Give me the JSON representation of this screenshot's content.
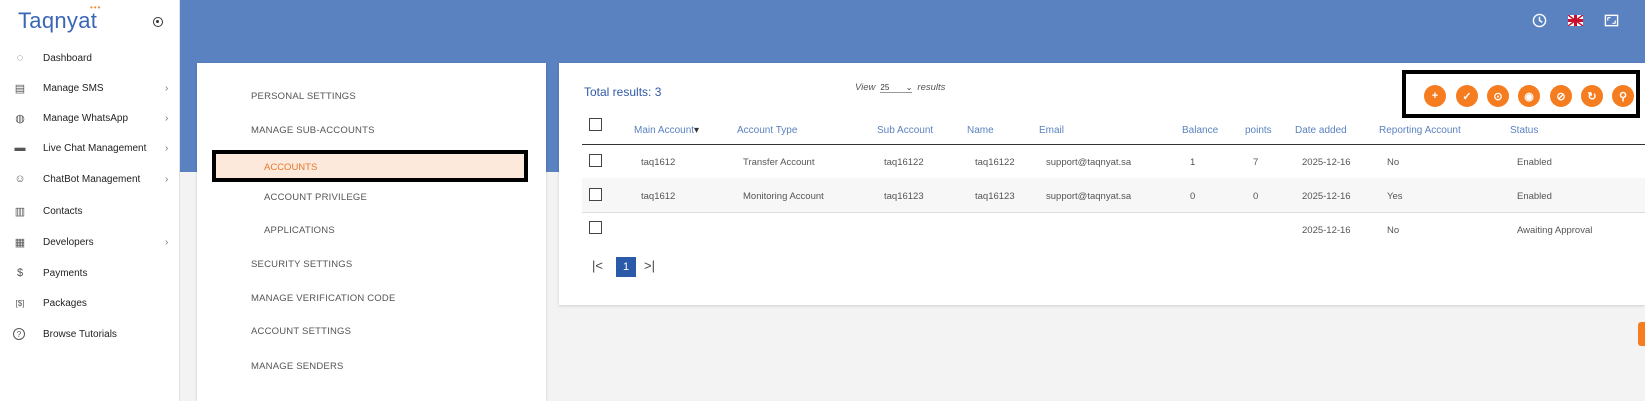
{
  "brand": {
    "name": "Taqnyat",
    "dots": "•••"
  },
  "sidebar": {
    "items": [
      {
        "label": "Dashboard",
        "icon": "dashboard-icon",
        "glyph": "◌",
        "chevron": false
      },
      {
        "label": "Manage SMS",
        "icon": "sms-icon",
        "glyph": "▤",
        "chevron": true
      },
      {
        "label": "Manage WhatsApp",
        "icon": "whatsapp-icon",
        "glyph": "◍",
        "chevron": true
      },
      {
        "label": "Live Chat Management",
        "icon": "chat-icon",
        "glyph": "▬",
        "chevron": true
      },
      {
        "label": "ChatBot Management",
        "icon": "robot-icon",
        "glyph": "☺",
        "chevron": true
      },
      {
        "label": "Contacts",
        "icon": "contacts-icon",
        "glyph": "▥",
        "chevron": false
      },
      {
        "label": "Developers",
        "icon": "developers-icon",
        "glyph": "▦",
        "chevron": true
      },
      {
        "label": "Payments",
        "icon": "dollar-icon",
        "glyph": "$",
        "chevron": false
      },
      {
        "label": "Packages",
        "icon": "packages-icon",
        "glyph": "[$]",
        "chevron": false
      },
      {
        "label": "Browse Tutorials",
        "icon": "help-icon",
        "glyph": "?",
        "chevron": false
      }
    ]
  },
  "topbar": {
    "icons": [
      "clock-icon",
      "uk-flag-icon",
      "fullscreen-icon"
    ]
  },
  "settings_menu": {
    "personal": "PERSONAL SETTINGS",
    "manage_sub": "MANAGE SUB-ACCOUNTS",
    "accounts": "ACCOUNTS",
    "privilege": "ACCOUNT PRIVILEGE",
    "applications": "APPLICATIONS",
    "security": "SECURITY SETTINGS",
    "verification": "MANAGE VERIFICATION CODE",
    "account_settings": "ACCOUNT SETTINGS",
    "senders": "MANAGE SENDERS"
  },
  "results": {
    "total": "Total results: 3",
    "view_label": "View",
    "view_value": "25",
    "results_label": "results"
  },
  "toolbar": {
    "buttons": [
      {
        "name": "add-button",
        "glyph": "+"
      },
      {
        "name": "approve-button",
        "glyph": "✓"
      },
      {
        "name": "activate-button",
        "glyph": "⊙"
      },
      {
        "name": "show-button",
        "glyph": "◉"
      },
      {
        "name": "hide-button",
        "glyph": "⊘"
      },
      {
        "name": "refresh-button",
        "glyph": "↻"
      },
      {
        "name": "search-button",
        "glyph": "⚲"
      }
    ]
  },
  "table": {
    "headers": [
      "Main Account",
      "Account Type",
      "Sub Account",
      "Name",
      "Email",
      "Balance",
      "points",
      "Date added",
      "Reporting Account",
      "Status"
    ],
    "sort_indicator": "▾",
    "rows": [
      [
        "taq1612",
        "Transfer Account",
        "taq16122",
        "taq16122",
        "support@taqnyat.sa",
        "1",
        "7",
        "2025-12-16",
        "No",
        "Enabled"
      ],
      [
        "taq1612",
        "Monitoring Account",
        "taq16123",
        "taq16123",
        "support@taqnyat.sa",
        "0",
        "0",
        "2025-12-16",
        "Yes",
        "Enabled"
      ],
      [
        "",
        "",
        "",
        "",
        "",
        "",
        "",
        "2025-12-16",
        "No",
        "Awaiting Approval"
      ]
    ]
  },
  "pagination": {
    "first": "|<",
    "current": "1",
    "last": ">|"
  },
  "colors": {
    "accent": "#f57c1f",
    "brand": "#5a82c1",
    "link": "#2f5aa8"
  }
}
